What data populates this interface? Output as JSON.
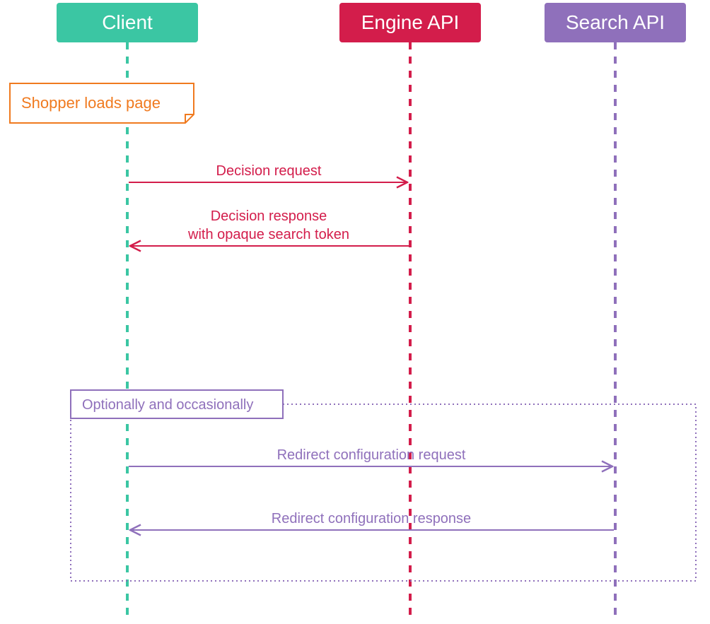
{
  "participants": [
    {
      "id": "client",
      "label": "Client",
      "fill": "#3bc6a3",
      "text": "#ffffff",
      "lifelineColor": "#3bc6a3"
    },
    {
      "id": "engine",
      "label": "Engine API",
      "fill": "#d31d4b",
      "text": "#ffffff",
      "lifelineColor": "#d31d4b"
    },
    {
      "id": "search",
      "label": "Search API",
      "fill": "#8f70bb",
      "text": "#ffffff",
      "lifelineColor": "#8f70bb"
    }
  ],
  "note": {
    "label": "Shopper loads page",
    "border": "#f07a1f",
    "text": "#f07a1f"
  },
  "messages": [
    {
      "id": "decision-request",
      "label": "Decision request",
      "from": "client",
      "to": "engine",
      "color": "#d31d4b"
    },
    {
      "id": "decision-response",
      "label": "Decision response",
      "label2": "with opaque search token",
      "from": "engine",
      "to": "client",
      "color": "#d31d4b"
    }
  ],
  "optional": {
    "title": "Optionally and occasionally",
    "color": "#8f70bb",
    "messages": [
      {
        "id": "redirect-request",
        "label": "Redirect configuration request",
        "from": "client",
        "to": "search",
        "color": "#8f70bb"
      },
      {
        "id": "redirect-response",
        "label": "Redirect configuration response",
        "from": "search",
        "to": "client",
        "color": "#8f70bb"
      }
    ]
  }
}
